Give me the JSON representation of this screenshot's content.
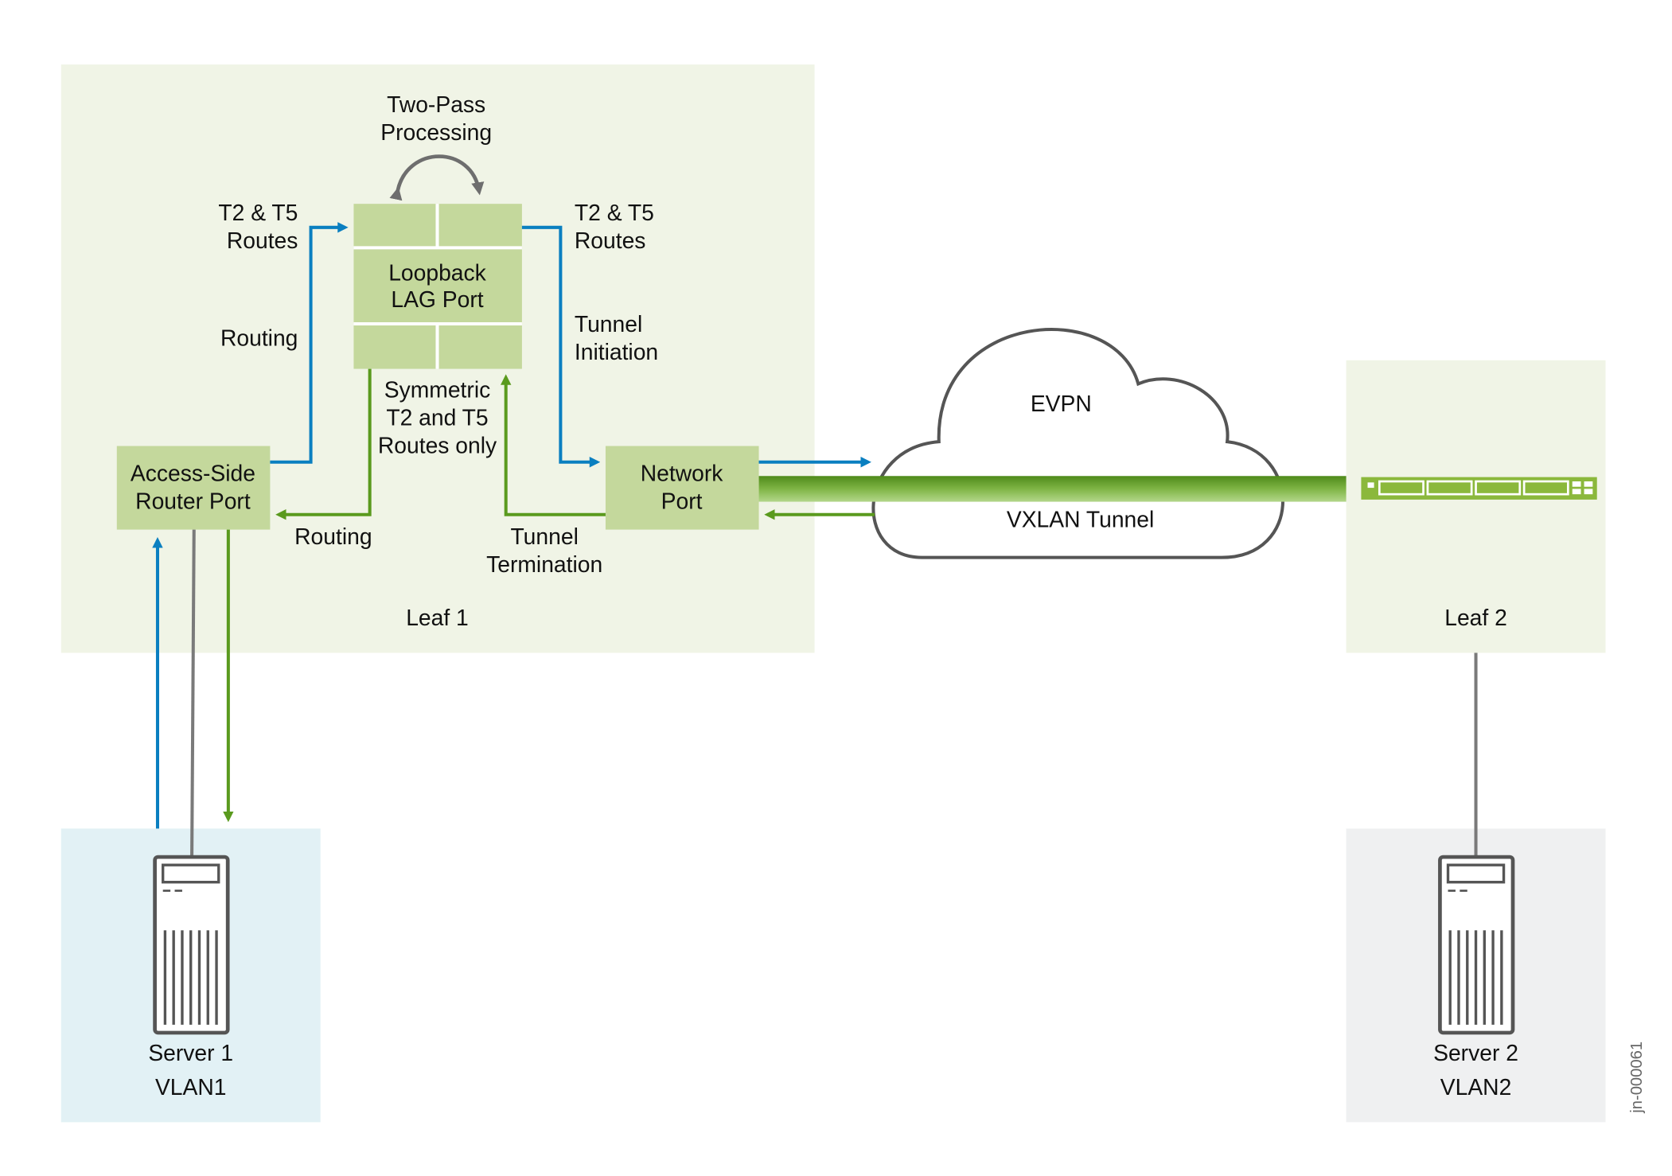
{
  "colors": {
    "leaf_bg": "#f0f4e6",
    "port_green": "#c4d89c",
    "server1_bg": "#e2f1f5",
    "server2_bg": "#eff0f1",
    "blue_path": "#0a7fc0",
    "green_path": "#5a9a1e",
    "gray_link": "#7a7a7a",
    "switch_green": "#8bb83c"
  },
  "two_pass": [
    "Two-Pass",
    "Processing"
  ],
  "loopback": [
    "Loopback",
    "LAG Port"
  ],
  "left_routes": [
    "T2 & T5",
    "Routes"
  ],
  "right_routes": [
    "T2 & T5",
    "Routes"
  ],
  "routing_up": "Routing",
  "tunnel_initiation": [
    "Tunnel",
    "Initiation"
  ],
  "symmetric": [
    "Symmetric",
    "T2 and T5",
    "Routes only"
  ],
  "access_port": [
    "Access-Side",
    "Router Port"
  ],
  "network_port": [
    "Network",
    "Port"
  ],
  "routing_down": "Routing",
  "tunnel_termination": [
    "Tunnel",
    "Termination"
  ],
  "leaf1": "Leaf 1",
  "leaf2": "Leaf 2",
  "evpn": "EVPN",
  "vxlan": "VXLAN Tunnel",
  "server1": [
    "Server 1",
    "VLAN1"
  ],
  "server2": [
    "Server 2",
    "VLAN2"
  ],
  "figure_id": "jn-000061",
  "icons": [
    "server-icon",
    "switch-icon",
    "cloud-icon"
  ]
}
